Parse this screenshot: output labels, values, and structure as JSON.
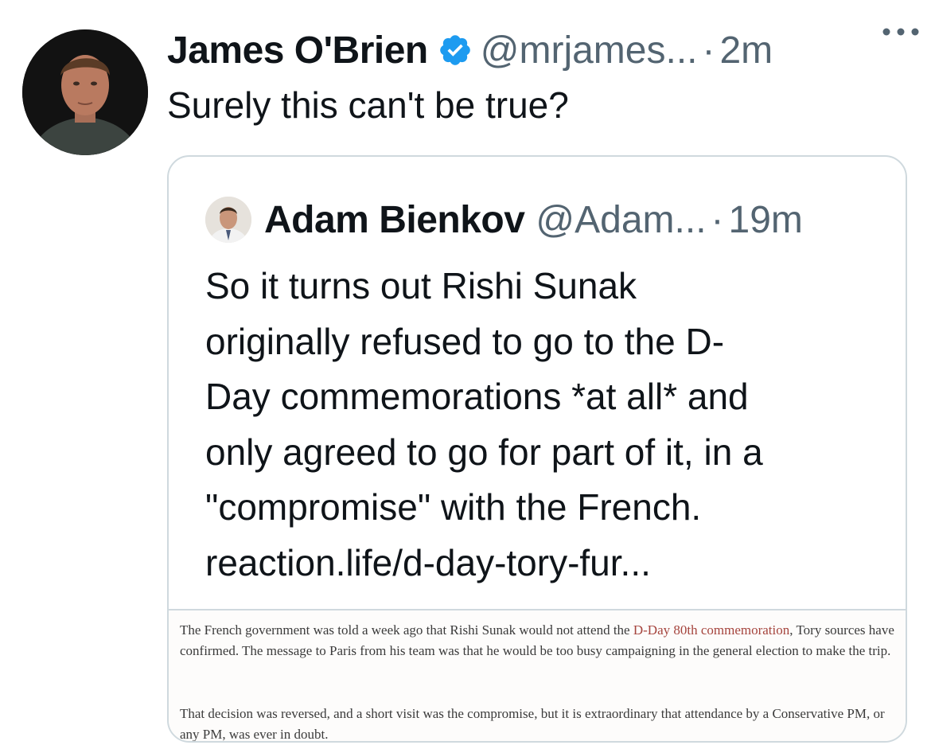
{
  "tweet": {
    "author_name": "James O'Brien",
    "author_handle": "@mrjames...",
    "separator": "·",
    "time": "2m",
    "text": "Surely this can't be true?",
    "icons": {
      "verified": "verified-badge-icon",
      "more": "more-options-icon"
    }
  },
  "quote": {
    "author_name": "Adam Bienkov",
    "author_handle": "@Adam...",
    "separator": "·",
    "time": "19m",
    "text_lines": [
      "So it turns out Rishi Sunak",
      "originally refused to go to the D-",
      "Day commemorations *at all* and",
      "only agreed to go for part of it, in a",
      "\"compromise\" with the French.",
      "reaction.life/d-day-tory-fur..."
    ],
    "article": {
      "p1_part1": "The French government was told a week ago that Rishi Sunak would not attend the ",
      "p1_link": "D-Day 80th commemoration",
      "p1_part2": ", Tory sources have confirmed. The message to Paris from his team was that he would be too busy campaigning in the general election to make the trip.",
      "p2": "That decision was reversed, and a short visit was the compromise, but it is extraordinary that attendance by a Conservative PM, or any PM, was ever in doubt."
    }
  },
  "colors": {
    "text": "#0f1419",
    "secondary": "#536471",
    "verified": "#1d9bf0",
    "border": "#cfd9de",
    "article_link": "#a5443d"
  }
}
